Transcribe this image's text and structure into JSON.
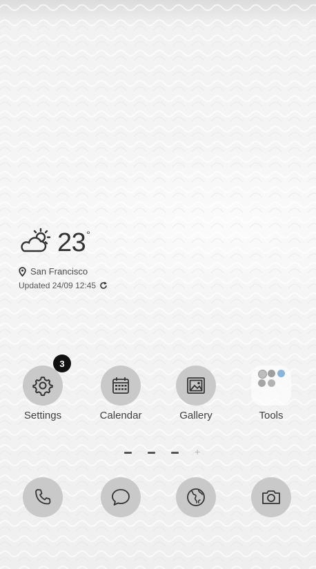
{
  "weather": {
    "temperature": "23",
    "unit": "°",
    "location": "San Francisco",
    "updated": "Updated 24/09 12:45",
    "icon": "partly-sunny-icon"
  },
  "apps": [
    {
      "label": "Settings",
      "icon": "gear-icon",
      "badge": "3"
    },
    {
      "label": "Calendar",
      "icon": "calendar-icon"
    },
    {
      "label": "Gallery",
      "icon": "image-icon"
    },
    {
      "label": "Tools",
      "icon": "folder-icon"
    }
  ],
  "dock": [
    {
      "icon": "phone-icon"
    },
    {
      "icon": "message-icon"
    },
    {
      "icon": "globe-icon"
    },
    {
      "icon": "camera-icon"
    }
  ],
  "pager": {
    "pages": 3,
    "active_index": 0
  }
}
